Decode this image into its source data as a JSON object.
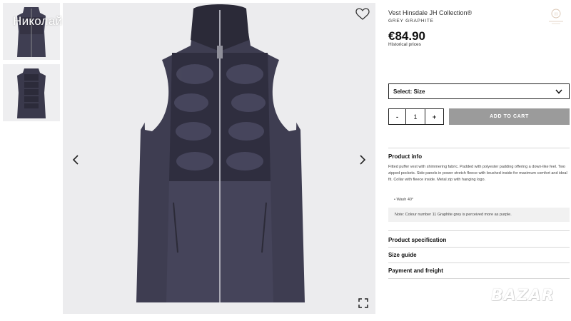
{
  "watermark": {
    "username": "Николай",
    "site": "BAZAR"
  },
  "gallery": {
    "thumbnails": [
      {
        "view": "front"
      },
      {
        "view": "back"
      }
    ],
    "product_color": "#3b3a4a",
    "background_color": "#ececee"
  },
  "product": {
    "title": "Vest Hinsdale JH Collection®",
    "color_name": "GREY GRAPHITE",
    "price": "€84.90",
    "historical_prices": "Historical prices"
  },
  "size_select": {
    "label": "Select: Size"
  },
  "quantity": {
    "minus": "-",
    "value": "1",
    "plus": "+"
  },
  "cart_button": {
    "label": "ADD TO CART",
    "color": "#9b9b9b"
  },
  "product_info": {
    "title": "Product info",
    "description": "Fitted puffer vest with shimmering fabric. Padded with polyester padding offering a down-like feel. Two zipped pockets. Side panels in power stretch fleece with brushed inside for maximum comfort and ideal fit. Collar with fleece inside. Metal zip with hanging logo.",
    "bullet": "Wash 40°",
    "note": "Note: Colour number 11 Graphite grey is perceived more as purple."
  },
  "accordions": [
    {
      "label": "Product specification"
    },
    {
      "label": "Size guide"
    },
    {
      "label": "Payment and freight"
    }
  ]
}
